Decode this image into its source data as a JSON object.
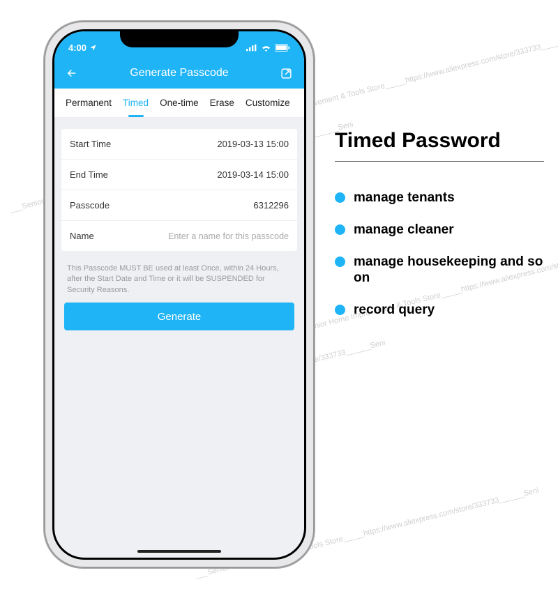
{
  "statusbar": {
    "time": "4:00"
  },
  "header": {
    "title": "Generate Passcode"
  },
  "tabs": [
    "Permanent",
    "Timed",
    "One-time",
    "Erase",
    "Customize"
  ],
  "activeTab": 1,
  "form": {
    "start_label": "Start Time",
    "start_value": "2019-03-13 15:00",
    "end_label": "End Time",
    "end_value": "2019-03-14 15:00",
    "passcode_label": "Passcode",
    "passcode_value": "6312296",
    "name_label": "Name",
    "name_placeholder": "Enter a name for this passcode"
  },
  "note": "This Passcode MUST BE used at least Once, within 24 Hours, after the Start Date and Time or it will be SUSPENDED for Security Reasons.",
  "generate_label": "Generate",
  "marketing": {
    "title": "Timed Password",
    "bullets": [
      "manage tenants",
      "manage cleaner",
      "manage housekeeping and so on",
      "record query"
    ]
  },
  "watermark_text": "___Senior  Home Improvement & Tools Store_____https://www.aliexpress.com/store/333733______Seni"
}
